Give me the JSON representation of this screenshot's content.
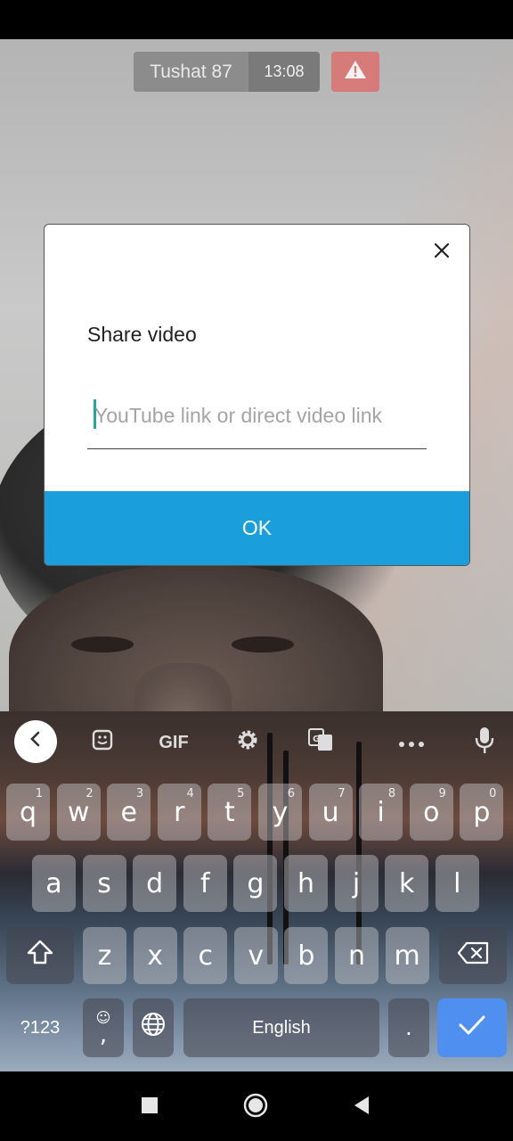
{
  "call": {
    "caller_name": "Tushat 87",
    "duration": "13:08",
    "warning_icon": "warning-triangle-icon"
  },
  "dialog": {
    "title": "Share video",
    "input_placeholder": "YouTube link or direct video link",
    "input_value": "",
    "ok_label": "OK",
    "close_icon": "close-icon"
  },
  "keyboard": {
    "toolbar": {
      "gif_label": "GIF",
      "icons": [
        "chevron-left-icon",
        "sticker-icon",
        "gif-icon",
        "gear-icon",
        "translate-icon",
        "more-icon",
        "microphone-icon"
      ]
    },
    "row1": [
      {
        "key": "q",
        "hint": "1"
      },
      {
        "key": "w",
        "hint": "2"
      },
      {
        "key": "e",
        "hint": "3"
      },
      {
        "key": "r",
        "hint": "4"
      },
      {
        "key": "t",
        "hint": "5"
      },
      {
        "key": "y",
        "hint": "6"
      },
      {
        "key": "u",
        "hint": "7"
      },
      {
        "key": "i",
        "hint": "8"
      },
      {
        "key": "o",
        "hint": "9"
      },
      {
        "key": "p",
        "hint": "0"
      }
    ],
    "row2": [
      "a",
      "s",
      "d",
      "f",
      "g",
      "h",
      "j",
      "k",
      "l"
    ],
    "row3": [
      "z",
      "x",
      "c",
      "v",
      "b",
      "n",
      "m"
    ],
    "symbols_label": "?123",
    "comma_label": ",",
    "space_label": "English",
    "period_label": "."
  },
  "colors": {
    "ok_button": "#1a9fdc",
    "warning_button": "#d77a7a",
    "enter_key": "#4f8ff0",
    "caret": "#1fa7a0"
  }
}
